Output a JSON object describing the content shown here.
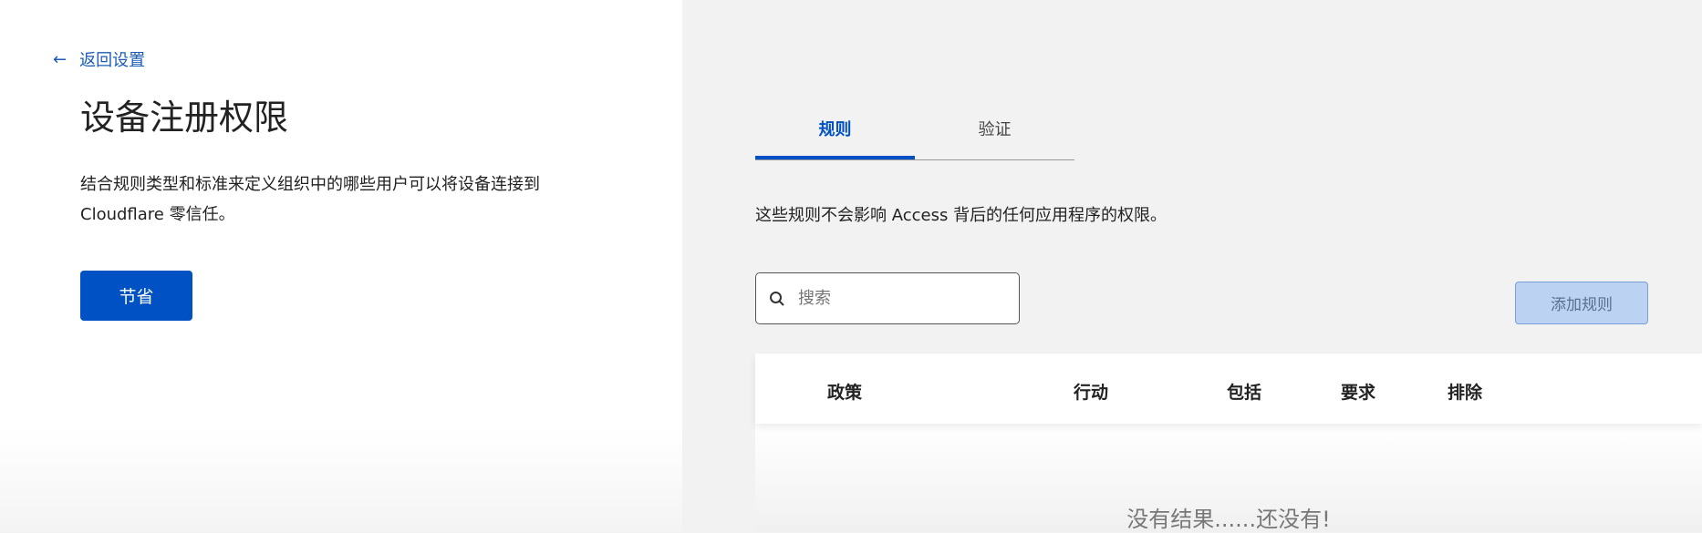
{
  "back_link": {
    "icon": "arrow-left-icon",
    "label": "返回设置"
  },
  "title": "设备注册权限",
  "description": "结合规则类型和标准来定义组织中的哪些用户可以将设备连接到 Cloudflare 零信任。",
  "save_label": "节省",
  "tabs": [
    {
      "label": "规则",
      "active": true
    },
    {
      "label": "验证",
      "active": false
    }
  ],
  "info_text": "这些规则不会影响 Access 背后的任何应用程序的权限。",
  "search": {
    "placeholder": "搜索",
    "value": ""
  },
  "add_rule_label": "添加规则",
  "table": {
    "headers": [
      "政策",
      "行动",
      "包括",
      "要求",
      "排除"
    ],
    "empty_text": "没有结果......还没有!"
  },
  "colors": {
    "accent": "#0051c3",
    "add_button_bg": "#bcd2f3"
  }
}
